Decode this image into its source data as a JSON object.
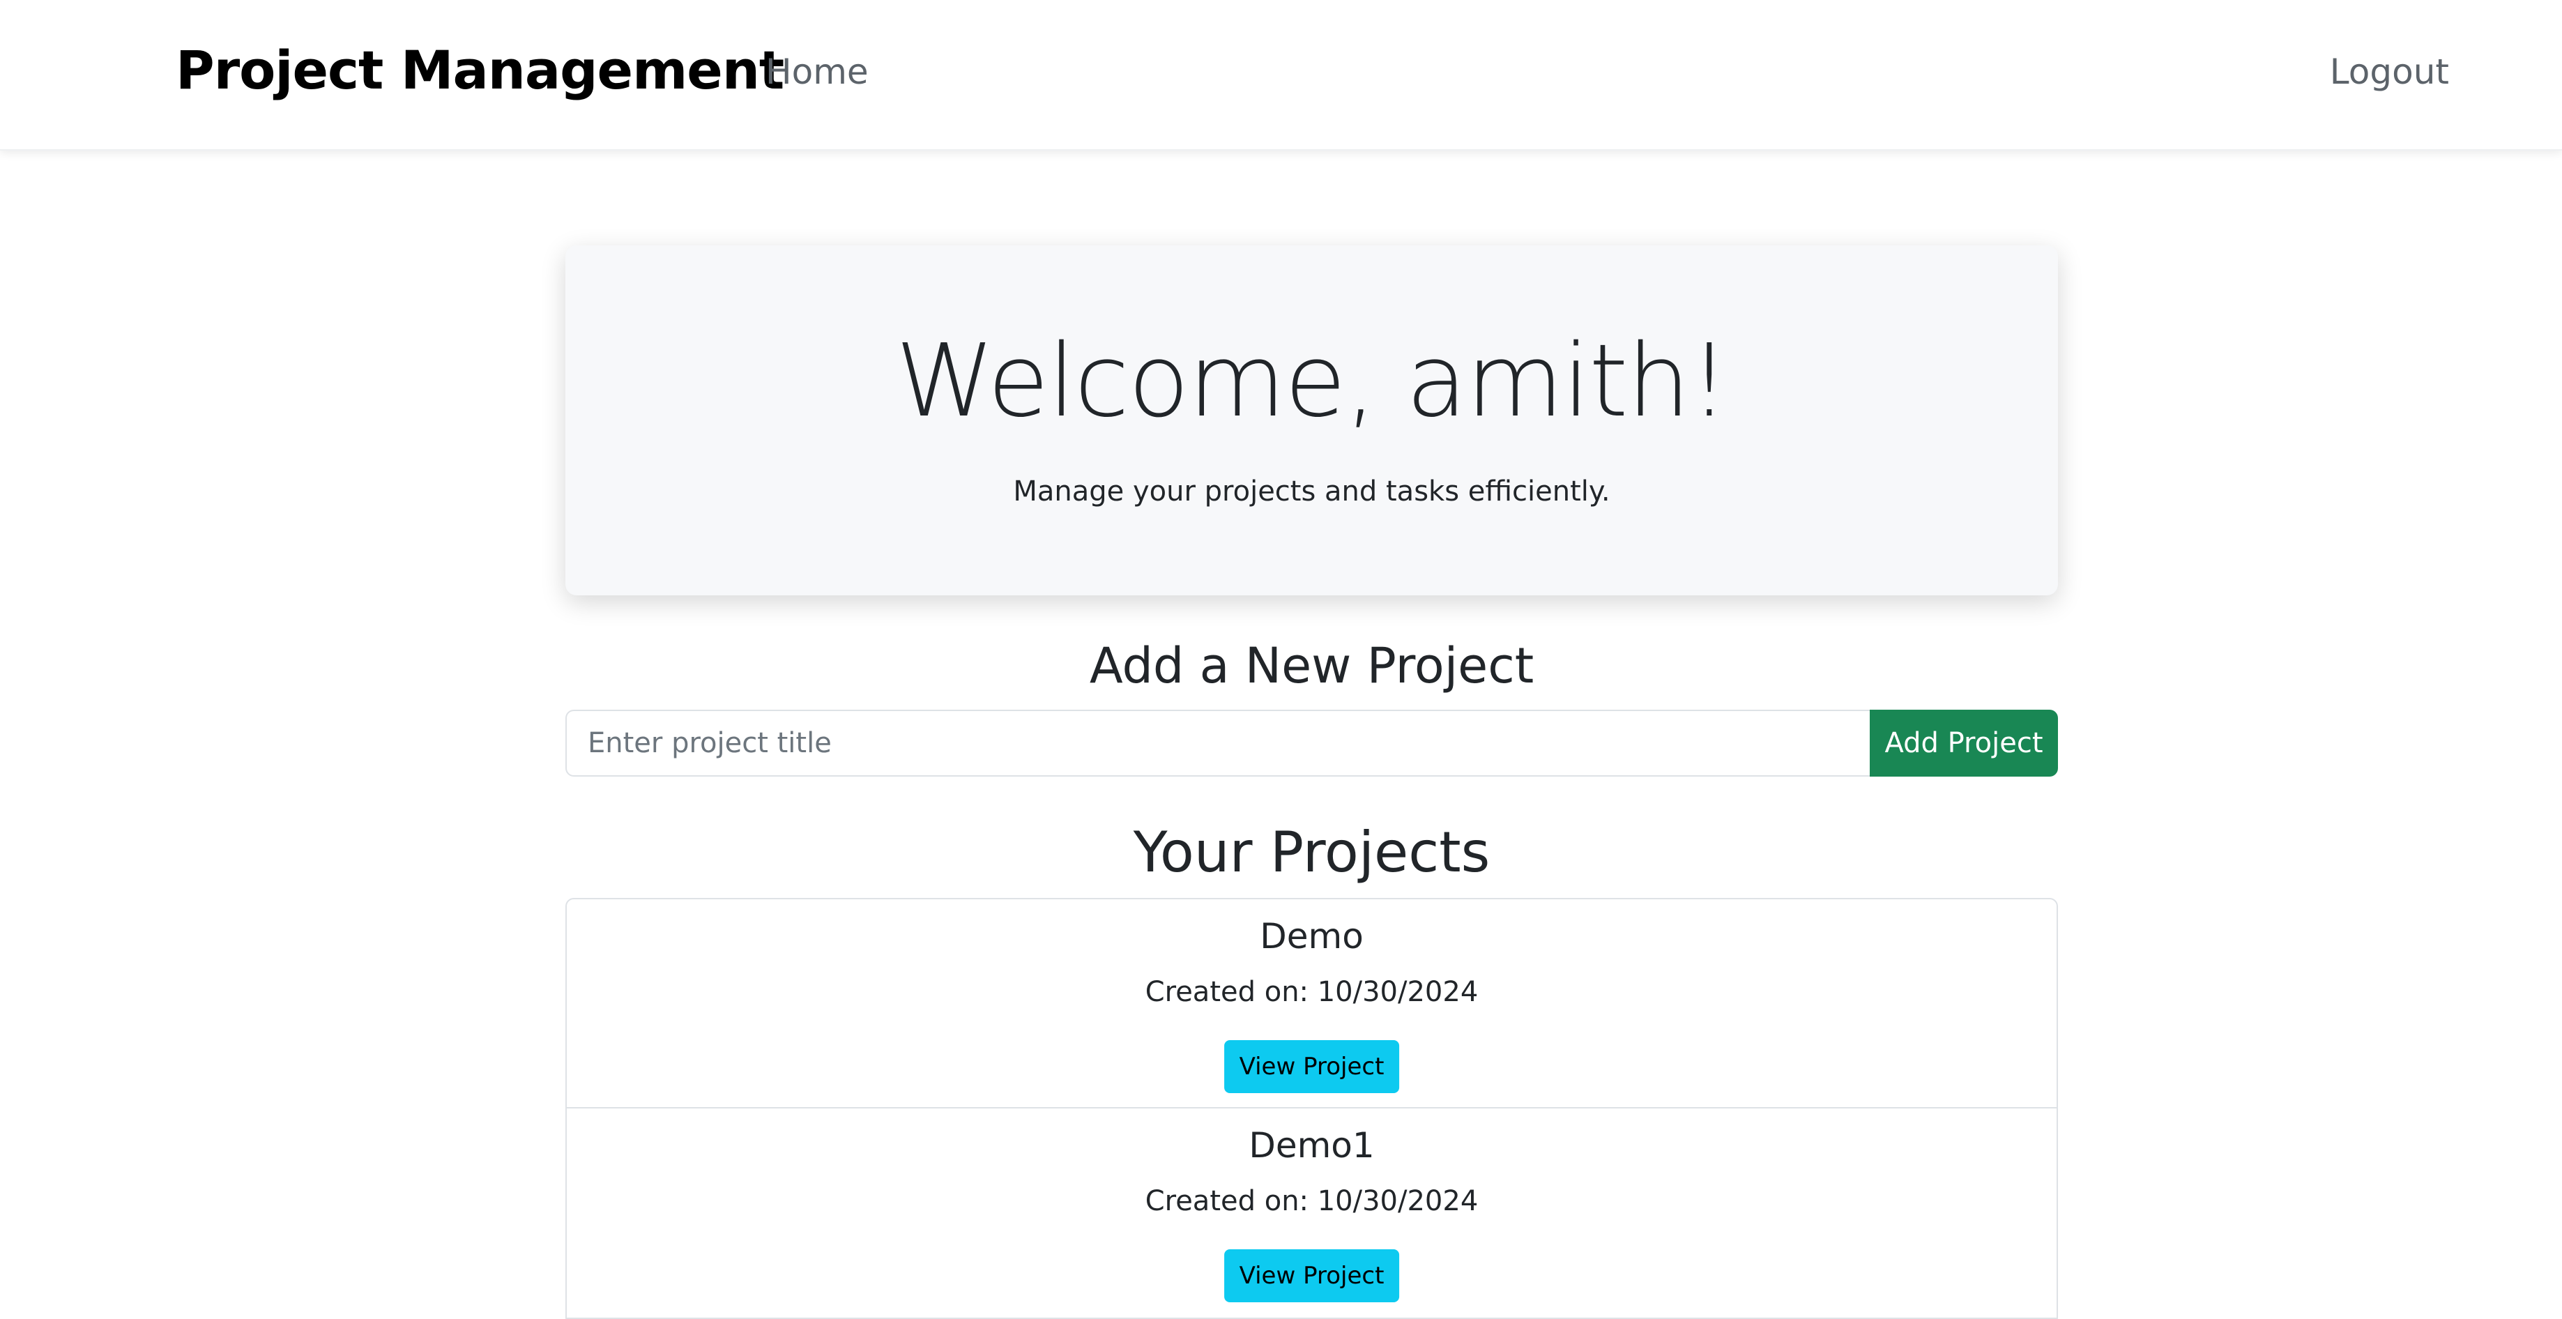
{
  "navbar": {
    "brand": "Project Management",
    "home_label": "Home",
    "logout_label": "Logout"
  },
  "hero": {
    "welcome": "Welcome, amith!",
    "subtitle": "Manage your projects and tasks efficiently."
  },
  "add_project": {
    "heading": "Add a New Project",
    "input_placeholder": "Enter project title",
    "input_value": "",
    "button_label": "Add Project"
  },
  "projects": {
    "heading": "Your Projects",
    "items": [
      {
        "title": "Demo",
        "created": "Created on: 10/30/2024",
        "button_label": "View Project"
      },
      {
        "title": "Demo1",
        "created": "Created on: 10/30/2024",
        "button_label": "View Project"
      }
    ]
  },
  "colors": {
    "accent_green": "#198754",
    "accent_cyan": "#0dcaf0",
    "hero_background": "#f7f8fa"
  }
}
